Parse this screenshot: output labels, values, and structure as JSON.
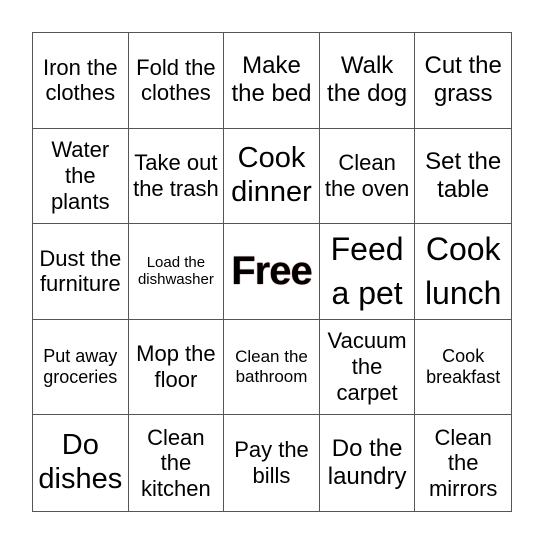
{
  "card": {
    "rows": [
      [
        "Iron the clothes",
        "Fold the clothes",
        "Make the bed",
        "Walk the dog",
        "Cut the grass"
      ],
      [
        "Water the plants",
        "Take out the trash",
        "Cook dinner",
        "Clean the oven",
        "Set the table"
      ],
      [
        "Dust the furniture",
        "Load the dishwasher",
        "Free",
        "Feed a pet",
        "Cook lunch"
      ],
      [
        "Put away groceries",
        "Mop the floor",
        "Clean the bathroom",
        "Vacuum the carpet",
        "Cook breakfast"
      ],
      [
        "Do dishes",
        "Clean the kitchen",
        "Pay the bills",
        "Do the laundry",
        "Clean the mirrors"
      ]
    ],
    "free_space": "Free"
  }
}
